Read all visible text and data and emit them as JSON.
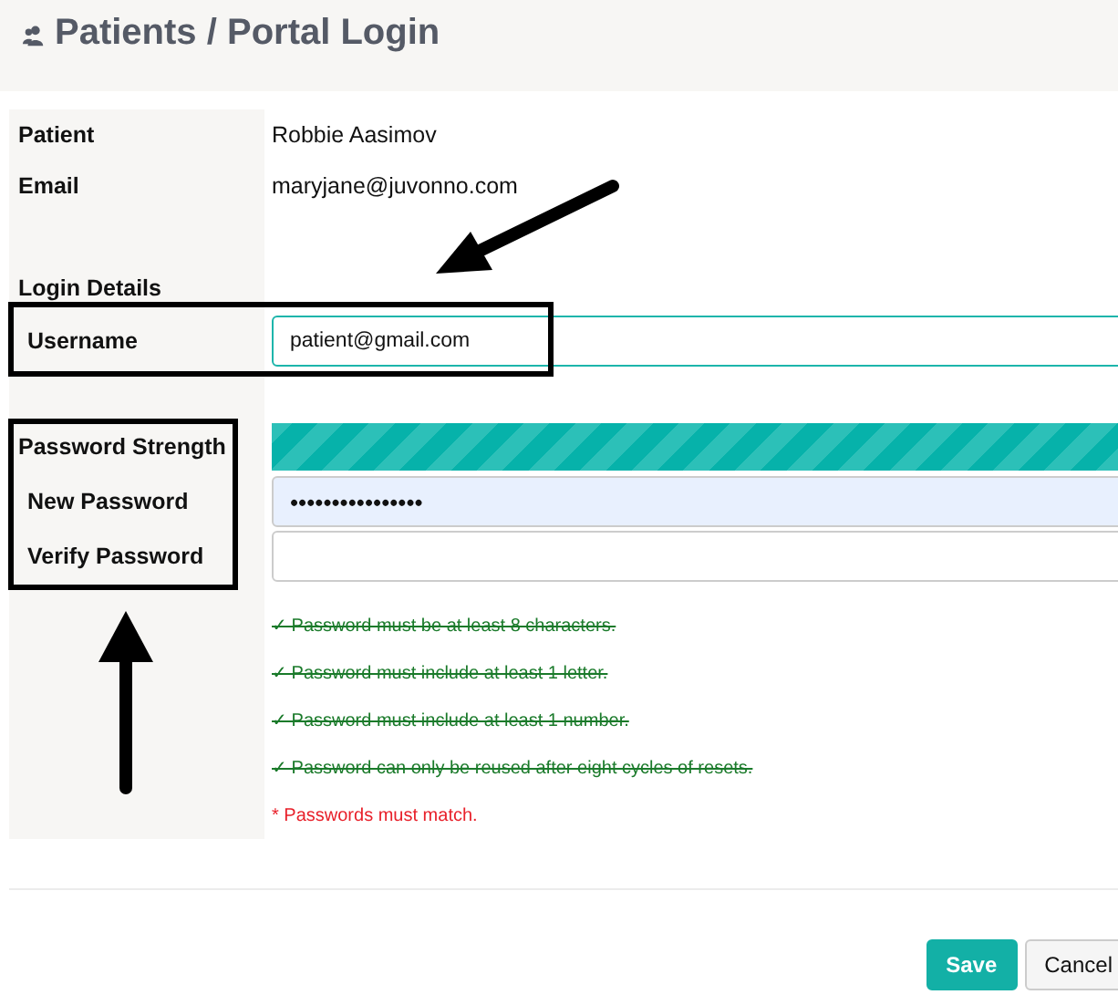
{
  "title": "Patients / Portal Login",
  "info": [
    {
      "label": "Patient",
      "value": "Robbie Aasimov"
    },
    {
      "label": "Email",
      "value": "maryjane@juvonno.com"
    }
  ],
  "section": "Login Details",
  "username": {
    "label": "Username",
    "value": "patient@gmail.com"
  },
  "strength": {
    "label": "Password Strength",
    "level": 1
  },
  "new_password": {
    "label": "New Password",
    "value": "••••••••••••••••"
  },
  "verify_password": {
    "label": "Verify Password"
  },
  "rules": [
    {
      "text": "✓ Password must be at least 8 characters.",
      "met": true
    },
    {
      "text": "✓ Password must include at least 1 letter.",
      "met": true
    },
    {
      "text": "✓ Password must include at least 1 number.",
      "met": true
    },
    {
      "text": "✓ Password can only be reused after eight cycles of resets.",
      "met": true
    },
    {
      "text": "* Passwords must match.",
      "met": false
    }
  ],
  "buttons": [
    {
      "label": "Save",
      "kind": "primary"
    },
    {
      "label": "Cancel",
      "kind": "secondary"
    }
  ]
}
